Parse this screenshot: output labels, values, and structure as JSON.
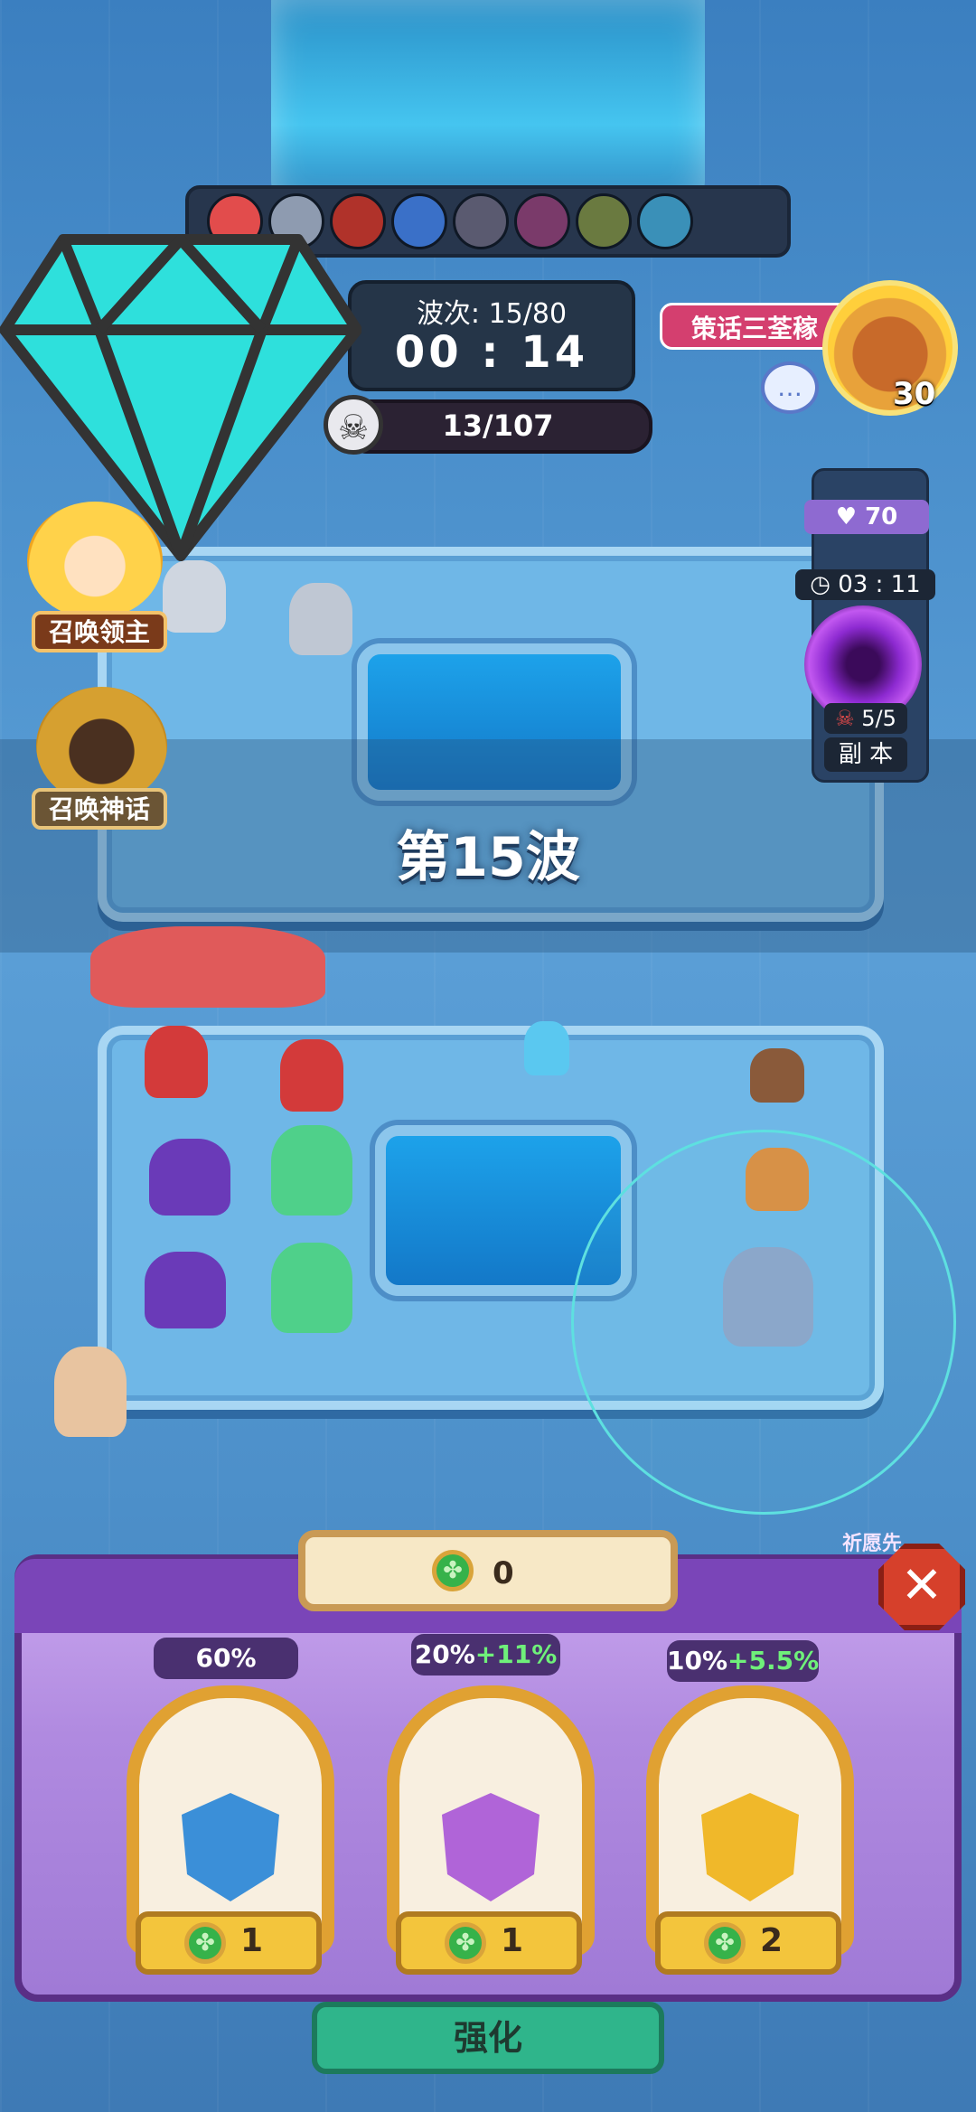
{
  "hud": {
    "wave_label": "波次: 15/80",
    "timer": "00 : 14",
    "kills": "13/107",
    "player_tag": "策话三荃稼",
    "player_level": "30"
  },
  "side_panel": {
    "hp": "70",
    "timer": "03 : 11",
    "enemy_count": "5/5",
    "dungeon_label": "副 本"
  },
  "summon": {
    "lord_label": "召唤领主",
    "myth_label": "召唤神话"
  },
  "battle": {
    "wave_banner": "第15波"
  },
  "shop": {
    "currency_value": "0",
    "wish_label": "祈愿先...",
    "cards": [
      {
        "rate": "60%",
        "bonus": "",
        "cost": "1",
        "gem_color": "#3b8fd8"
      },
      {
        "rate": "20%",
        "bonus": "+11%",
        "cost": "1",
        "gem_color": "#b064d8"
      },
      {
        "rate": "10%",
        "bonus": "+5.5%",
        "cost": "2",
        "gem_color": "#f0b82a"
      }
    ],
    "upgrade_label": "强化"
  },
  "colors": {
    "accent_purple": "#7a45b8",
    "gold": "#e0a132",
    "diamond": "#2ee0dc"
  }
}
